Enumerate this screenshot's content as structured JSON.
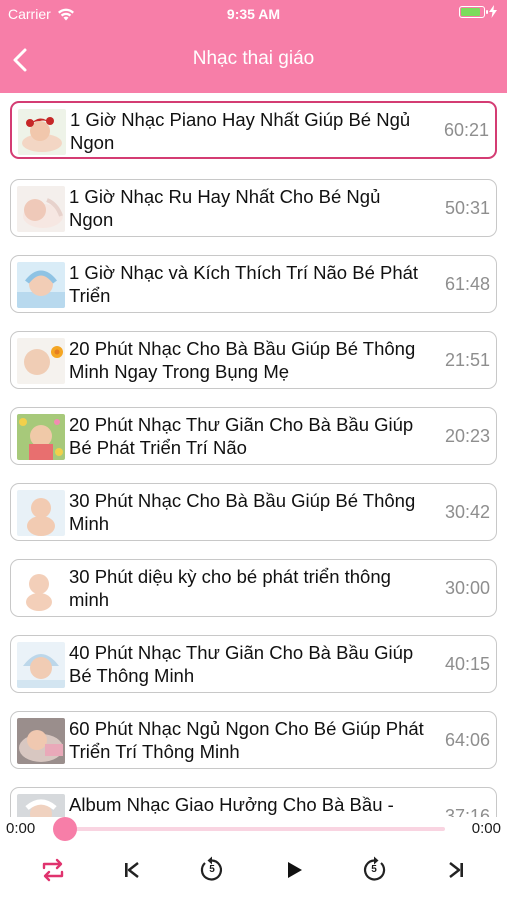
{
  "status_bar": {
    "carrier": "Carrier",
    "time": "9:35 AM"
  },
  "nav": {
    "title": "Nhạc thai giáo"
  },
  "tracks": [
    {
      "title": "1 Giờ Nhạc Piano Hay Nhất Giúp Bé Ngủ Ngon",
      "duration": "60:21"
    },
    {
      "title": "1 Giờ Nhạc Ru Hay Nhất Cho Bé Ngủ Ngon",
      "duration": "50:31"
    },
    {
      "title": "1 Giờ Nhạc và Kích Thích Trí Não Bé Phát Triển",
      "duration": "61:48"
    },
    {
      "title": "20 Phút Nhạc Cho Bà Bầu Giúp Bé Thông Minh Ngay Trong Bụng Mẹ",
      "duration": "21:51"
    },
    {
      "title": "20 Phút Nhạc Thư Giãn Cho Bà Bầu Giúp Bé Phát Triển Trí Não",
      "duration": "20:23"
    },
    {
      "title": "30 Phút Nhạc Cho Bà Bầu Giúp Bé Thông Minh",
      "duration": "30:42"
    },
    {
      "title": "30 Phút diệu kỳ cho bé phát triển thông minh",
      "duration": "30:00"
    },
    {
      "title": "40 Phút Nhạc Thư Giãn Cho Bà Bầu Giúp Bé Thông Minh",
      "duration": "40:15"
    },
    {
      "title": "60 Phút Nhạc Ngủ Ngon Cho Bé Giúp Phát Triển Trí Thông Minh",
      "duration": "64:06"
    },
    {
      "title": "Album Nhạc Giao Hưởng Cho Bà Bầu -",
      "duration": "37:16"
    }
  ],
  "player": {
    "elapsed": "0:00",
    "total": "0:00",
    "progress": 0,
    "accent_color": "#f77ea8",
    "controls": [
      "repeat-icon",
      "skip-previous-icon",
      "rewind-5-icon",
      "play-icon",
      "forward-5-icon",
      "skip-next-icon"
    ],
    "rewind_label": "5",
    "forward_label": "5"
  }
}
